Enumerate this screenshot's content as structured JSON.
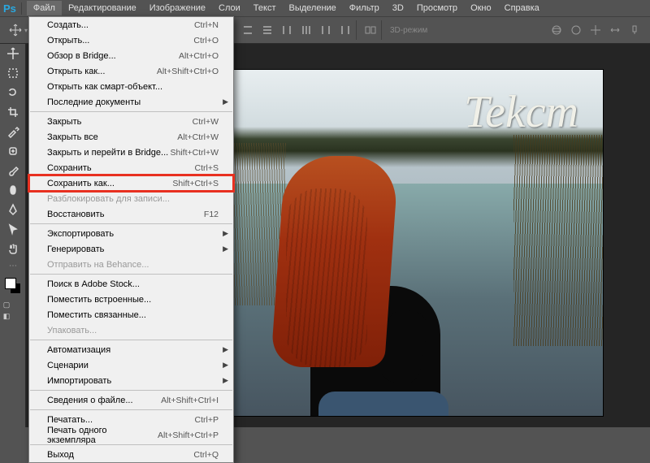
{
  "app_logo": "Ps",
  "menubar": [
    "Файл",
    "Редактирование",
    "Изображение",
    "Слои",
    "Текст",
    "Выделение",
    "Фильтр",
    "3D",
    "Просмотр",
    "Окно",
    "Справка"
  ],
  "active_menu_index": 0,
  "optbar_3d_label": "3D-режим",
  "file_menu": {
    "groups": [
      [
        {
          "label": "Создать...",
          "shortcut": "Ctrl+N"
        },
        {
          "label": "Открыть...",
          "shortcut": "Ctrl+O"
        },
        {
          "label": "Обзор в Bridge...",
          "shortcut": "Alt+Ctrl+O"
        },
        {
          "label": "Открыть как...",
          "shortcut": "Alt+Shift+Ctrl+O"
        },
        {
          "label": "Открыть как смарт-объект..."
        },
        {
          "label": "Последние документы",
          "submenu": true
        }
      ],
      [
        {
          "label": "Закрыть",
          "shortcut": "Ctrl+W"
        },
        {
          "label": "Закрыть все",
          "shortcut": "Alt+Ctrl+W"
        },
        {
          "label": "Закрыть и перейти в Bridge...",
          "shortcut": "Shift+Ctrl+W"
        },
        {
          "label": "Сохранить",
          "shortcut": "Ctrl+S"
        },
        {
          "label": "Сохранить как...",
          "shortcut": "Shift+Ctrl+S",
          "highlighted": true
        },
        {
          "label": "Разблокировать для записи...",
          "disabled": true
        },
        {
          "label": "Восстановить",
          "shortcut": "F12"
        }
      ],
      [
        {
          "label": "Экспортировать",
          "submenu": true
        },
        {
          "label": "Генерировать",
          "submenu": true
        },
        {
          "label": "Отправить на Behance...",
          "disabled": true
        }
      ],
      [
        {
          "label": "Поиск в Adobe Stock..."
        },
        {
          "label": "Поместить встроенные..."
        },
        {
          "label": "Поместить связанные..."
        },
        {
          "label": "Упаковать...",
          "disabled": true
        }
      ],
      [
        {
          "label": "Автоматизация",
          "submenu": true
        },
        {
          "label": "Сценарии",
          "submenu": true
        },
        {
          "label": "Импортировать",
          "submenu": true
        }
      ],
      [
        {
          "label": "Сведения о файле...",
          "shortcut": "Alt+Shift+Ctrl+I"
        }
      ],
      [
        {
          "label": "Печатать...",
          "shortcut": "Ctrl+P"
        },
        {
          "label": "Печать одного экземпляра",
          "shortcut": "Alt+Shift+Ctrl+P"
        }
      ],
      [
        {
          "label": "Выход",
          "shortcut": "Ctrl+Q"
        }
      ]
    ]
  },
  "canvas_text": "Tekcm"
}
